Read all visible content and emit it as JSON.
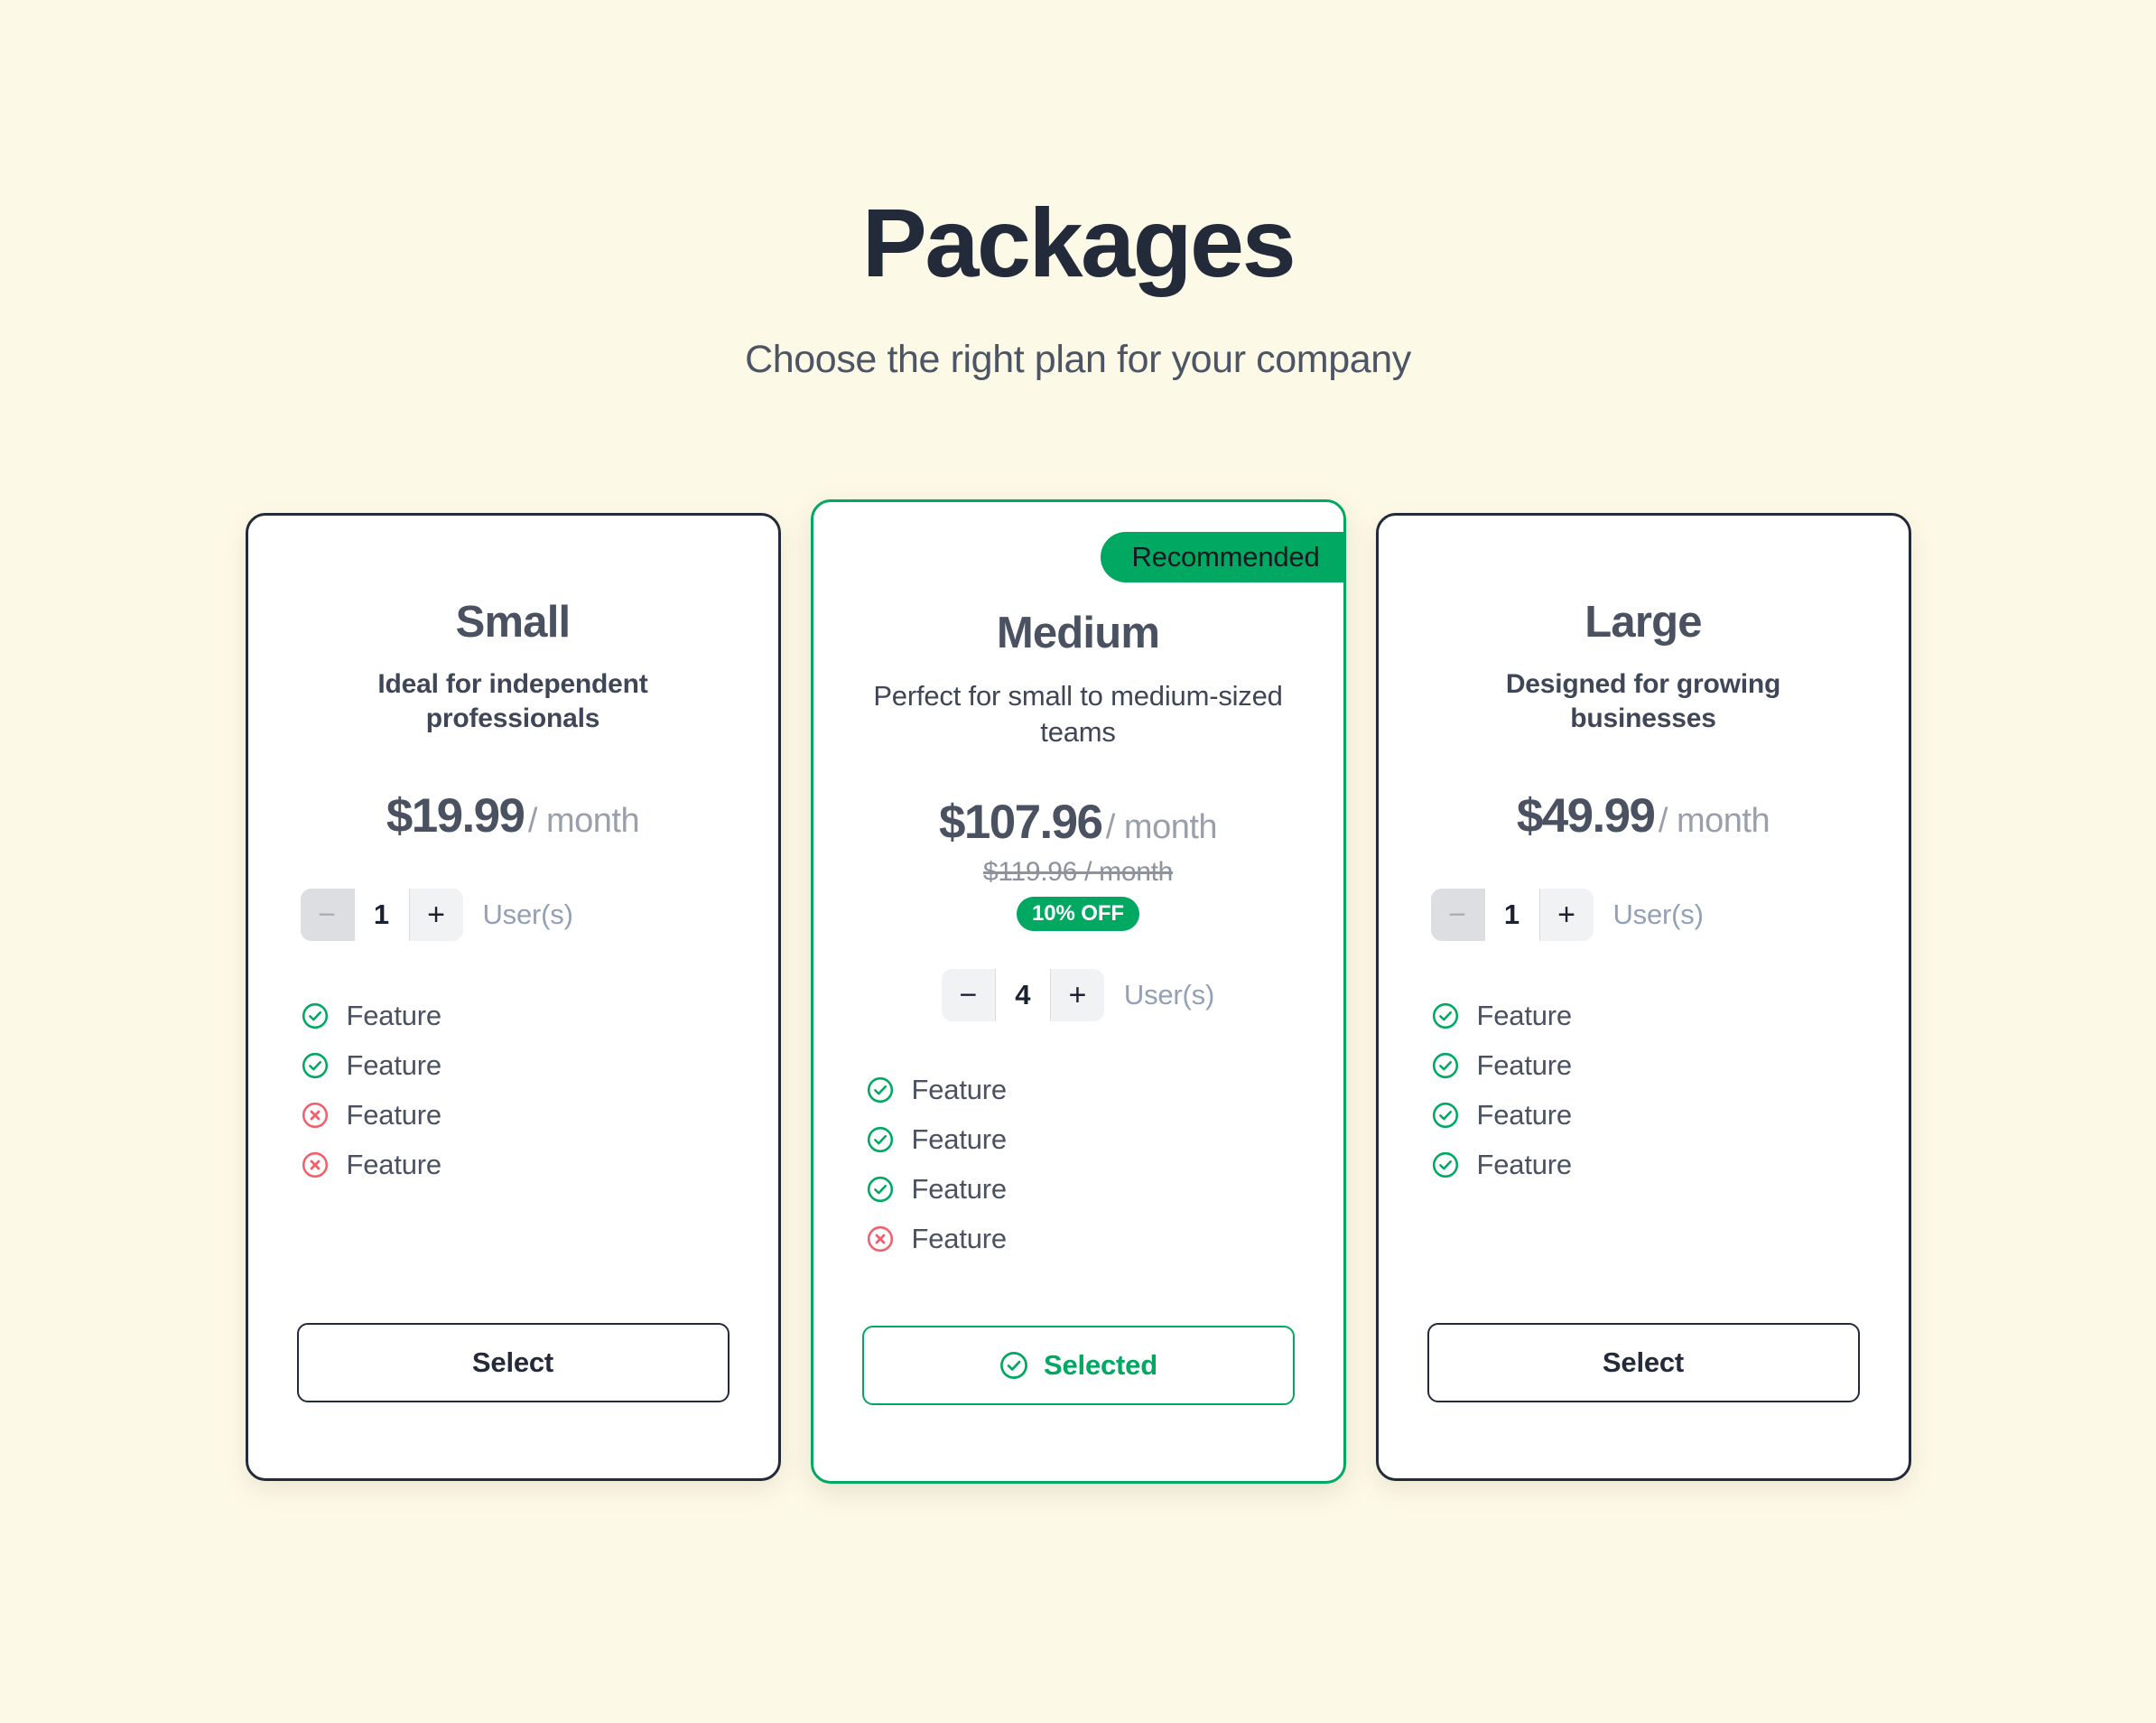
{
  "header": {
    "title": "Packages",
    "subtitle": "Choose the right plan for your company"
  },
  "colors": {
    "background": "#FDF9E7",
    "title": "#232B3B",
    "accent_green": "#00A861",
    "danger_red": "#F2606B",
    "card_border_dark": "#232B3B",
    "muted_text": "#93A0B6"
  },
  "stepper_labels": {
    "decrement": "−",
    "increment": "+",
    "unit": "User(s)"
  },
  "plans": [
    {
      "id": "small",
      "name": "Small",
      "description": "Ideal for independent professionals",
      "price": "$19.99",
      "period": "/ month",
      "old_price": "",
      "discount": "",
      "recommended_label": "",
      "quantity": "1",
      "decrement_disabled": true,
      "features": [
        {
          "label": "Feature",
          "included": true
        },
        {
          "label": "Feature",
          "included": true
        },
        {
          "label": "Feature",
          "included": false
        },
        {
          "label": "Feature",
          "included": false
        }
      ],
      "action_label": "Select",
      "selected": false
    },
    {
      "id": "medium",
      "name": "Medium",
      "description": "Perfect for small to medium-sized teams",
      "price": "$107.96",
      "period": "/ month",
      "old_price": "$119.96 / month",
      "discount": "10% OFF",
      "recommended_label": "Recommended",
      "quantity": "4",
      "decrement_disabled": false,
      "features": [
        {
          "label": "Feature",
          "included": true
        },
        {
          "label": "Feature",
          "included": true
        },
        {
          "label": "Feature",
          "included": true
        },
        {
          "label": "Feature",
          "included": false
        }
      ],
      "action_label": "Selected",
      "selected": true
    },
    {
      "id": "large",
      "name": "Large",
      "description": "Designed for growing businesses",
      "price": "$49.99",
      "period": "/ month",
      "old_price": "",
      "discount": "",
      "recommended_label": "",
      "quantity": "1",
      "decrement_disabled": true,
      "features": [
        {
          "label": "Feature",
          "included": true
        },
        {
          "label": "Feature",
          "included": true
        },
        {
          "label": "Feature",
          "included": true
        },
        {
          "label": "Feature",
          "included": true
        }
      ],
      "action_label": "Select",
      "selected": false
    }
  ]
}
